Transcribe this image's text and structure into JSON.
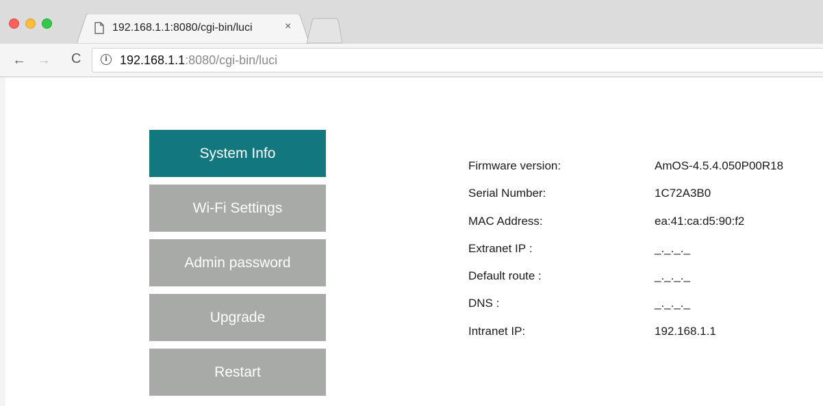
{
  "browser": {
    "tab": {
      "title": "192.168.1.1:8080/cgi-bin/luci",
      "close_label": "×",
      "icon": "document-icon"
    },
    "nav": {
      "back_label": "←",
      "forward_label": "→",
      "reload_label": "C"
    },
    "address": {
      "info_label": "i",
      "host": "192.168.1.1",
      "rest": ":8080/cgi-bin/luci"
    },
    "colors": {
      "close": "#fc605c",
      "minimize": "#fdbc40",
      "zoom": "#34c84a"
    }
  },
  "menu": {
    "items": [
      {
        "label": "System Info",
        "active": true
      },
      {
        "label": "Wi-Fi Settings",
        "active": false
      },
      {
        "label": "Admin password",
        "active": false
      },
      {
        "label": "Upgrade",
        "active": false
      },
      {
        "label": "Restart",
        "active": false
      }
    ],
    "colors": {
      "active": "#137780",
      "inactive": "#a7aaa7"
    }
  },
  "system_info": {
    "rows": [
      {
        "label": "Firmware version:",
        "value": "AmOS-4.5.4.050P00R18"
      },
      {
        "label": "Serial Number:",
        "value": "1C72A3B0"
      },
      {
        "label": "MAC Address:",
        "value": "ea:41:ca:d5:90:f2"
      },
      {
        "label": "Extranet IP :",
        "value": "_._._._"
      },
      {
        "label": "Default route :",
        "value": "_._._._"
      },
      {
        "label": "DNS :",
        "value": "_._._._"
      },
      {
        "label": "Intranet IP:",
        "value": "192.168.1.1"
      }
    ]
  }
}
